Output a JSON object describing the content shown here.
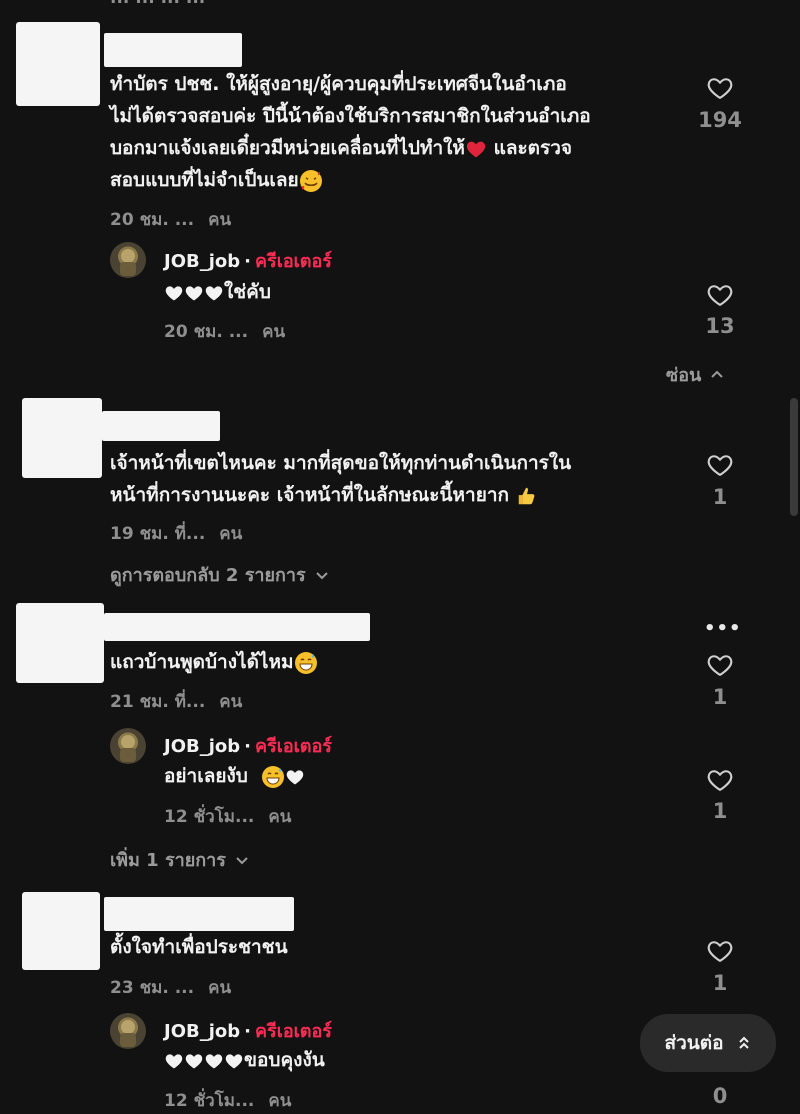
{
  "comments": [
    {
      "text_lines": [
        "ทำบัตร ปชช. ให้ผู้สูงอายุ/ผู้ควบคุมที่ประเทศจีนในอำเภอ",
        "ไม่ได้ตรวจสอบค่ะ ปีนี้น้าต้องใช้บริการสมาชิกในส่วนอำเภอ",
        "บอกมาแจ้งเลยเดี๋ยวมีหน่วยเคลื่อนที่ไปทำให้",
        "สอบแบบที่ไม่จำเป็นเลย"
      ],
      "line3_after_emoji": "และตรวจ",
      "meta_time": "20 ชม. ...",
      "meta_user": "คน",
      "likes": "194"
    },
    {
      "text_lines": [
        "เจ้าหน้าที่เขตไหนคะ มากที่สุดขอให้ทุกท่านดำเนินการใน",
        "หน้าที่การงานนะคะ เจ้าหน้าที่ในลักษณะนี้หายาก"
      ],
      "meta_time": "19 ชม. ที่...",
      "meta_user": "คน",
      "likes": "1"
    },
    {
      "text_lines": [
        "แถวบ้านพูดบ้างได้ไหม"
      ],
      "meta_time": "21 ชม. ที่...",
      "meta_user": "คน",
      "likes": "1"
    },
    {
      "text_lines": [
        "ตั้งใจทำเพื่อประชาชน"
      ],
      "meta_time": "23 ชม. ...",
      "meta_user": "คน",
      "likes": "1"
    }
  ],
  "replies": [
    {
      "author": "JOB_job",
      "dot": "·",
      "badge": "ครีเอเตอร์",
      "text": "ใช่คับ",
      "meta_time": "20 ชม. ...",
      "meta_user": "คน",
      "likes": "13"
    },
    {
      "author": "JOB_job",
      "dot": "·",
      "badge": "ครีเอเตอร์",
      "text": "อย่าเลยงับ",
      "meta_time": "12 ชั่วโม...",
      "meta_user": "คน",
      "likes": "1"
    },
    {
      "author": "JOB_job",
      "dot": "·",
      "badge": "ครีเอเตอร์",
      "text": "ขอบคุงงัน",
      "meta_time": "12 ชั่วโม...",
      "meta_user": "คน",
      "likes": "0"
    }
  ],
  "links": {
    "hide": "ซ่อน",
    "view_replies": "ดูการตอบกลับ 2 รายการ",
    "more_one": "เพิ่ม 1 รายการ",
    "continue": "ส่วนต่อ"
  },
  "more_menu": "•••",
  "top_cut": "... ... ... ...",
  "icons": {
    "like": "heart-outline-icon",
    "chevron_up": "chevron-up-icon",
    "chevron_down": "chevron-down-icon",
    "red_heart": "red-heart-emoji",
    "smile_hearts": "smiling-hearts-emoji",
    "thumbs_up": "thumbs-up-emoji",
    "grin_sweat": "grin-sweat-emoji",
    "white_heart": "white-heart-emoji",
    "double_chevron_up": "double-chevron-up-icon"
  },
  "colors": {
    "background": "#121212",
    "creator_badge": "#fe2c55",
    "muted": "#8f8f8f",
    "placeholder": "#f5f5f5"
  }
}
